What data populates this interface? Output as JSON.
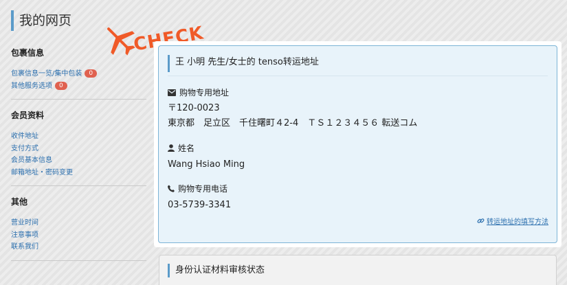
{
  "page": {
    "title": "我的网页"
  },
  "stamp": {
    "text": "CHECK",
    "icon": "airplane-icon",
    "color": "#f05a28"
  },
  "sidebar": {
    "sections": [
      {
        "heading": "包裹信息",
        "items": [
          {
            "label": "包裹信息一览/集中包装",
            "badge": "0"
          },
          {
            "label": "其他服务选项",
            "badge": "0"
          }
        ]
      },
      {
        "heading": "会员资料",
        "items": [
          {
            "label": "收件地址"
          },
          {
            "label": "支付方式"
          },
          {
            "label": "会员基本信息"
          },
          {
            "label": "邮箱地址・密码变更"
          }
        ]
      },
      {
        "heading": "其他",
        "items": [
          {
            "label": "营业时间"
          },
          {
            "label": "注意事项"
          },
          {
            "label": "联系我们"
          }
        ]
      }
    ]
  },
  "address_card": {
    "title": "王 小明 先生/女士的 tenso转运地址",
    "address": {
      "icon": "envelope-icon",
      "label": "购物专用地址",
      "postal": "〒120-0023",
      "line": "東京都　足立区　千住曙町４2-4　ＴＳ１２３４５６ 転送コム"
    },
    "name": {
      "icon": "user-icon",
      "label": "姓名",
      "value": "Wang Hsiao Ming"
    },
    "phone": {
      "icon": "phone-icon",
      "label": "购物专用电话",
      "value": "03-5739-3341"
    },
    "help_link": {
      "icon": "link-icon",
      "label": "转运地址的填写方法"
    }
  },
  "id_card": {
    "title": "身份认证材料审核状态"
  },
  "colors": {
    "accent": "#5b9bc9",
    "link": "#2b6fae",
    "badge": "#e0614f"
  }
}
